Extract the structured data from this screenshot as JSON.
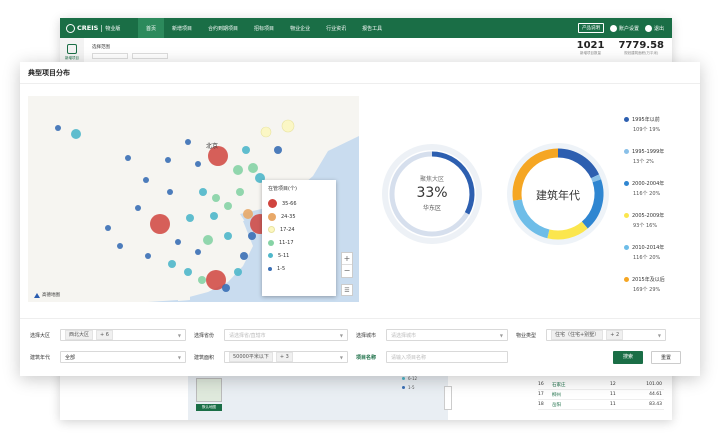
{
  "app": {
    "brand": "CREIS",
    "brand_sub": "中指数据",
    "module": "物业版",
    "nav": [
      "首页",
      "新增项目",
      "合约到期项目",
      "招标项目",
      "物业企业",
      "行业资讯",
      "报告工具"
    ],
    "product_btn": "产品说明",
    "account": "账户设置",
    "logout": "退出"
  },
  "bg": {
    "sidebar_label": "新增项目",
    "filter_label": "选择范围",
    "filter_ph1": "选择大区",
    "filter_ph2": "选择省份",
    "stat1_num": "1021",
    "stat1_lab": "新增项目数量",
    "stat2_num": "7779.58",
    "stat2_lab": "规划建筑面积(万平米)",
    "thumb_label": "默认地图",
    "legend2": [
      "6-12",
      "1-5"
    ],
    "table": [
      {
        "no": "16",
        "name": "石家庄",
        "count": "12",
        "value": "101.00"
      },
      {
        "no": "17",
        "name": "柳州",
        "count": "11",
        "value": "44.61"
      },
      {
        "no": "18",
        "name": "岳阳",
        "count": "11",
        "value": "83.43"
      }
    ]
  },
  "card": {
    "title": "典型项目分布"
  },
  "map": {
    "city_label": "北京",
    "legend_title": "在管项目(个)",
    "legend": [
      {
        "label": "35-66",
        "color": "#d0443e",
        "size": 9
      },
      {
        "label": "24-35",
        "color": "#e8a868",
        "size": 8
      },
      {
        "label": "17-24",
        "color": "#fcf7c0",
        "size": 7
      },
      {
        "label": "11-17",
        "color": "#86d3a5",
        "size": 6
      },
      {
        "label": "5-11",
        "color": "#4fb7ca",
        "size": 5
      },
      {
        "label": "1-5",
        "color": "#3a6fb5",
        "size": 4
      }
    ],
    "zoom_in": "+",
    "zoom_out": "−",
    "list_icon": "☰",
    "logo_text": "高德地图"
  },
  "donut_region": {
    "title": "聚焦大区",
    "percent": "33%",
    "region": "华东区",
    "fraction": 0.33,
    "colors": {
      "active": "#2d5fb0",
      "track": "#d6dfed",
      "outer": "#edf1f6"
    }
  },
  "donut_year": {
    "center_label": "建筑年代",
    "slices": [
      {
        "label": "1995年以前",
        "detail": "109个 19%",
        "value": 19,
        "color": "#2d5fb0"
      },
      {
        "label": "1995-1999年",
        "detail": "13个 2%",
        "value": 2,
        "color": "#89c0e8"
      },
      {
        "label": "2000-2004年",
        "detail": "116个 20%",
        "value": 20,
        "color": "#2f86d1"
      },
      {
        "label": "2005-2009年",
        "detail": "93个 16%",
        "value": 16,
        "color": "#fbe64e"
      },
      {
        "label": "2010-2014年",
        "detail": "116个 20%",
        "value": 20,
        "color": "#6ebde8"
      },
      {
        "label": "2015年及以后",
        "detail": "169个 29%",
        "value": 29,
        "color": "#f5a623"
      }
    ]
  },
  "filters": {
    "region_label": "选择大区",
    "region_tag": "西北大区",
    "region_more": "+ 6",
    "province_label": "选择省份",
    "province_ph": "请选择省/直辖市",
    "city_label": "选择城市",
    "city_ph": "请选择城市",
    "type_label": "物业类型",
    "type_tag": "住宅（住宅+别墅）",
    "type_more": "+ 2",
    "year_label": "建筑年代",
    "year_value": "全部",
    "area_label": "建筑面积",
    "area_tag": "50000平米以下",
    "area_more": "+ 3",
    "name_label": "项目名称",
    "name_ph": "请输入项目名称",
    "search_btn": "搜索",
    "reset_btn": "重置"
  }
}
